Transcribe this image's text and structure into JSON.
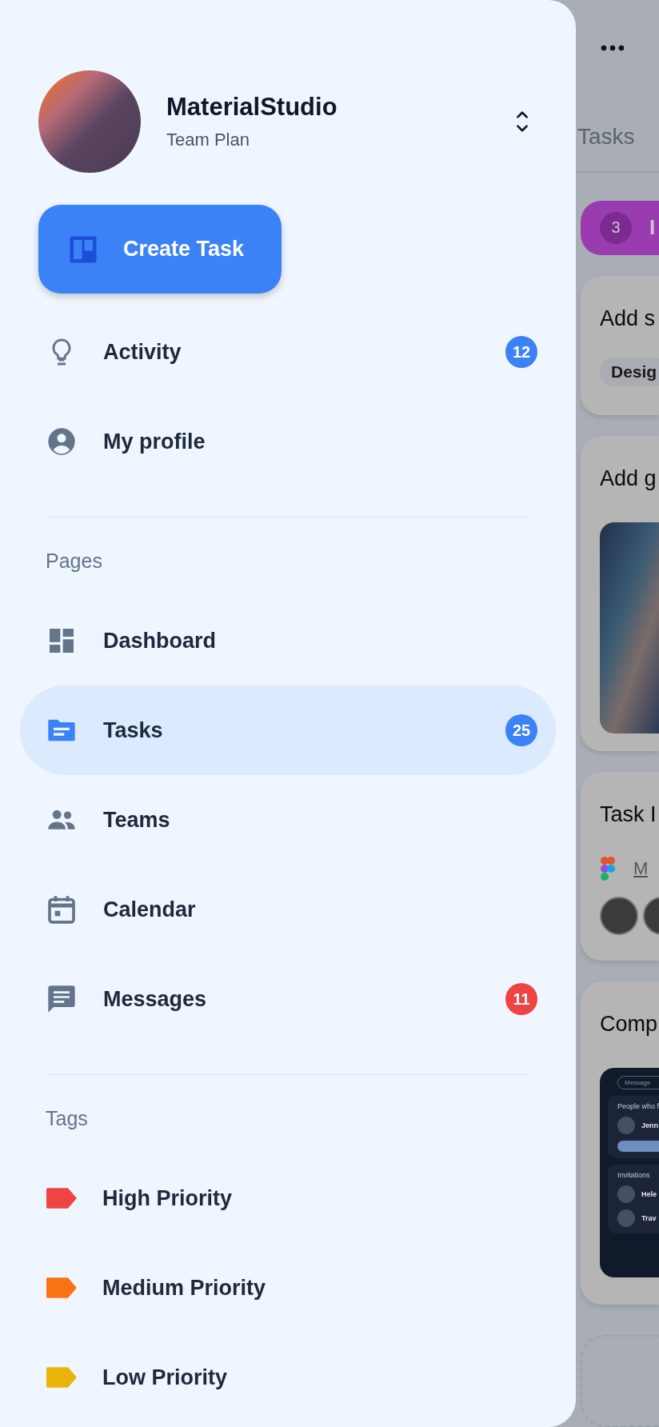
{
  "account": {
    "name": "MaterialStudio",
    "plan": "Team Plan"
  },
  "create_button": {
    "label": "Create Task"
  },
  "top_items": [
    {
      "label": "Activity",
      "selected": false,
      "badge": {
        "text": "12",
        "color": "#3b82f6"
      }
    },
    {
      "label": "My profile",
      "selected": false
    }
  ],
  "pages": {
    "heading": "Pages",
    "items": [
      {
        "label": "Dashboard",
        "selected": false
      },
      {
        "label": "Tasks",
        "selected": true,
        "badge": {
          "text": "25",
          "color": "#3b82f6"
        }
      },
      {
        "label": "Teams",
        "selected": false
      },
      {
        "label": "Calendar",
        "selected": false
      },
      {
        "label": "Messages",
        "selected": false,
        "badge": {
          "text": "11",
          "color": "#ef4444"
        }
      }
    ]
  },
  "tags": {
    "heading": "Tags",
    "items": [
      {
        "label": "High Priority",
        "color": "#ef4444"
      },
      {
        "label": "Medium Priority",
        "color": "#f97316"
      },
      {
        "label": "Low Priority",
        "color": "#eab308"
      }
    ]
  },
  "background_page": {
    "tab": "Tasks",
    "column": {
      "count": "3",
      "title": "I"
    },
    "cards": [
      {
        "kind": "tags",
        "title": "Add s",
        "tags": [
          "Desig"
        ]
      },
      {
        "kind": "image",
        "title": "Add g"
      },
      {
        "kind": "people",
        "title": "Task I",
        "link": "M"
      },
      {
        "kind": "screenshot",
        "title": "Comp",
        "screenshot": {
          "field": "Message",
          "section": "People who f",
          "person": "Jenn",
          "invitations": "Invitations",
          "invites": [
            "Hele",
            "Trav"
          ]
        }
      }
    ]
  }
}
